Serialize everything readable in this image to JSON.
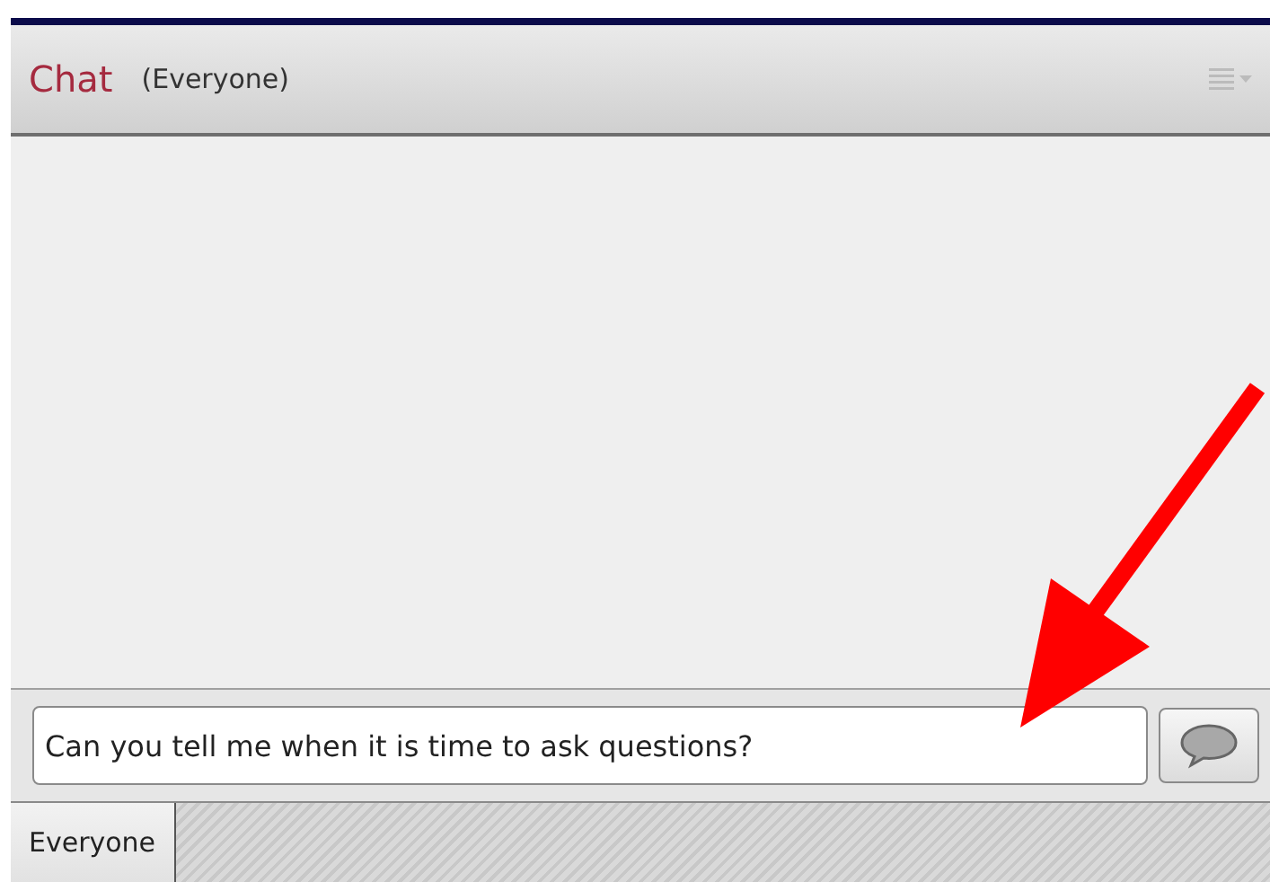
{
  "panel": {
    "title": "Chat",
    "audience": "(Everyone)"
  },
  "message_input": {
    "value": "Can you tell me when it is time to ask questions?"
  },
  "tabs": [
    {
      "label": "Everyone",
      "selected": true
    }
  ]
}
